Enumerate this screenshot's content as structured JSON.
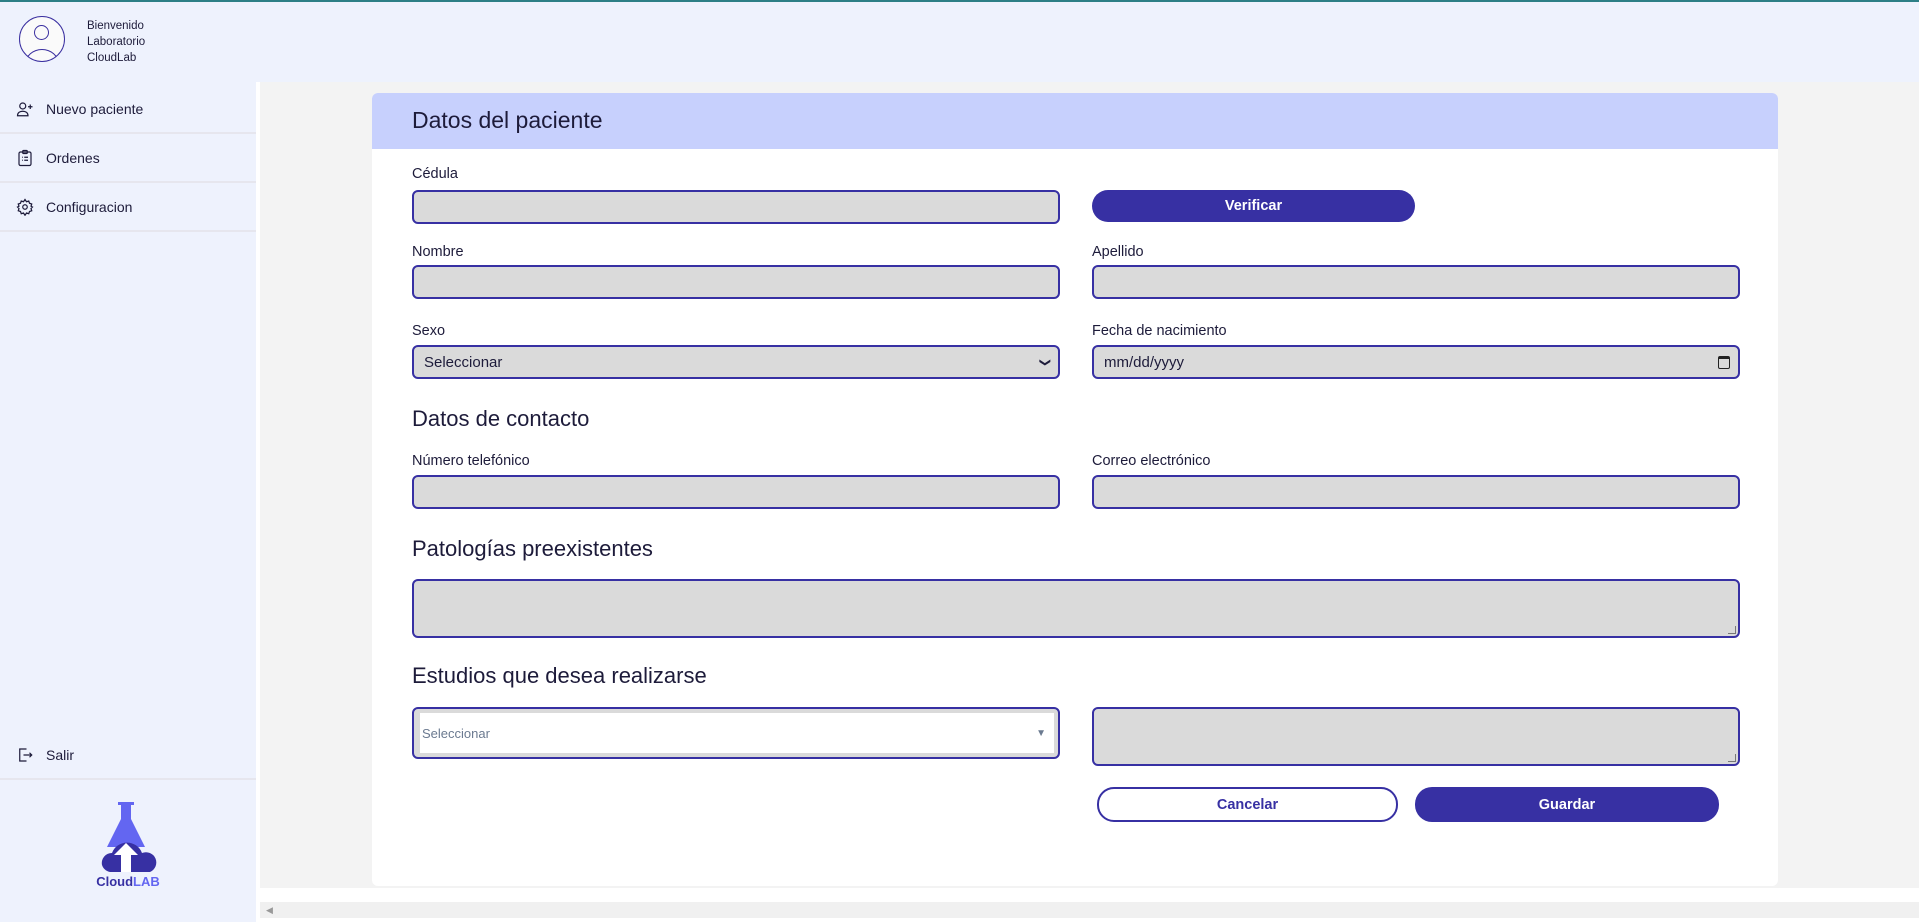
{
  "header": {
    "welcome_lines": [
      "Bienvenido",
      "Laboratorio",
      "CloudLab"
    ]
  },
  "sidebar": {
    "items": [
      {
        "label": "Nuevo paciente",
        "icon": "user-plus-icon"
      },
      {
        "label": "Ordenes",
        "icon": "clipboard-list-icon"
      },
      {
        "label": "Configuracion",
        "icon": "gear-icon"
      }
    ],
    "logout": {
      "label": "Salir",
      "icon": "logout-icon"
    },
    "logo": {
      "text_a": "Cloud",
      "text_b": "LAB"
    }
  },
  "form": {
    "title": "Datos del paciente",
    "cedula_label": "Cédula",
    "verify_label": "Verificar",
    "nombre_label": "Nombre",
    "apellido_label": "Apellido",
    "sexo_label": "Sexo",
    "sexo_value": "Seleccionar",
    "fecha_label": "Fecha de nacimiento",
    "fecha_placeholder": "mm/dd/yyyy",
    "contact_heading": "Datos de contacto",
    "telefono_label": "Número telefónico",
    "correo_label": "Correo electrónico",
    "patologias_heading": "Patologías preexistentes",
    "estudios_heading": "Estudios que desea realizarse",
    "estudios_placeholder": "Seleccionar",
    "cancel_label": "Cancelar",
    "save_label": "Guardar"
  },
  "colors": {
    "primary": "#3730a3",
    "header": "#c7d0fd",
    "sidebar": "#eef2fd"
  }
}
